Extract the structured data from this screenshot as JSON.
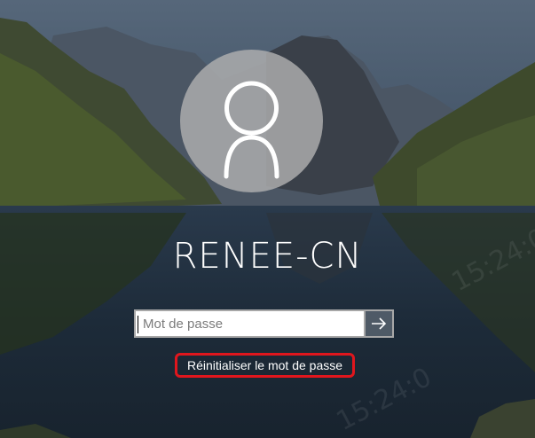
{
  "user": {
    "name": "RENEE-CN"
  },
  "password": {
    "placeholder": "Mot de passe",
    "value": ""
  },
  "reset_link": {
    "label": "Réinitialiser le mot de passe",
    "highlight_color": "#e0161d"
  },
  "watermark": {
    "text_1": "15:24:0",
    "text_2": "15:24:0"
  },
  "icons": {
    "avatar": "user-silhouette-icon",
    "submit": "arrow-right-icon"
  }
}
